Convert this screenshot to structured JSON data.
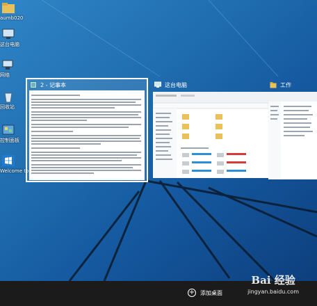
{
  "desktop_icons": [
    {
      "label": "aumb020",
      "icon": "user-folder-icon"
    },
    {
      "label": "这台电脑",
      "icon": "computer-icon"
    },
    {
      "label": "网络",
      "icon": "network-icon"
    },
    {
      "label": "回收站",
      "icon": "recycle-bin-icon"
    },
    {
      "label": "控制面板",
      "icon": "control-panel-icon"
    },
    {
      "label": "Welcome to Tech Previ...",
      "icon": "windows-icon"
    }
  ],
  "task_view": {
    "windows": [
      {
        "title": "2 - 记事本",
        "icon": "notepad-icon",
        "selected": true
      },
      {
        "title": "这台电脑",
        "icon": "computer-icon",
        "selected": false
      },
      {
        "title": "工作",
        "icon": "folder-icon",
        "selected": false
      }
    ]
  },
  "taskbar": {
    "add_desktop_label": "添加桌面",
    "add_desktop_icon": "plus-circle-icon"
  },
  "watermark": {
    "brand": "Bai 经验",
    "url": "jingyan.baidu.com"
  },
  "colors": {
    "desktop_blue": "#1f6cae",
    "taskbar": "#1b1b1b",
    "selection_border": "#ffffff",
    "drive_bar_blue": "#2b8ed8",
    "drive_bar_red": "#d63a3a"
  }
}
